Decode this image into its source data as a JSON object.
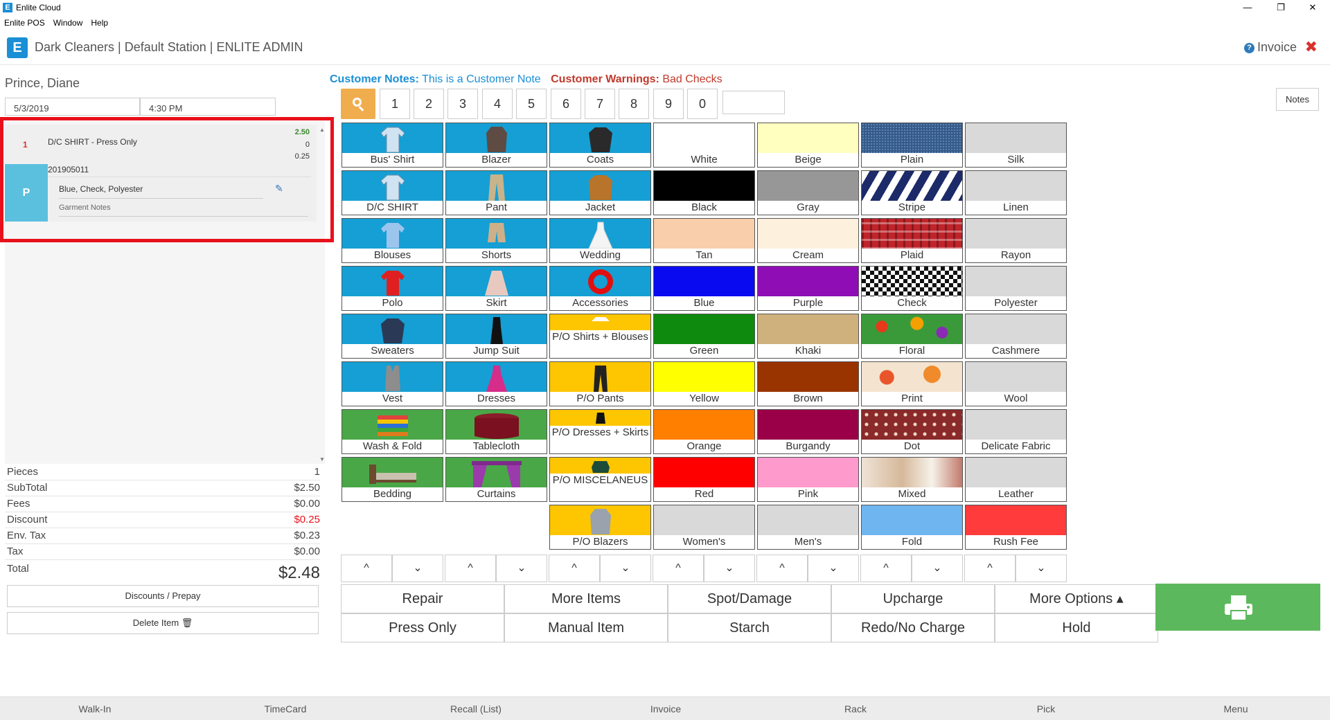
{
  "window": {
    "title": "Enlite Cloud",
    "minimize": "—",
    "restore": "❐",
    "close": "✕"
  },
  "menu": [
    "Enlite POS",
    "Window",
    "Help"
  ],
  "header": {
    "station": "Dark Cleaners | Default Station | ENLITE ADMIN",
    "invoice_label": "Invoice",
    "close_icon": "✖"
  },
  "customer": {
    "name": "Prince, Diane",
    "date": "5/3/2019",
    "time": "4:30 PM"
  },
  "item": {
    "qty": "1",
    "title": "D/C SHIRT - Press Only",
    "price": "2.50",
    "v2": "0",
    "v3": "0.25",
    "ticket": "201905011",
    "badge": "P",
    "attributes": "Blue, Check, Polyester",
    "notes": "Garment Notes"
  },
  "summary": {
    "pieces_label": "Pieces",
    "pieces": "1",
    "subtotal_label": "SubTotal",
    "subtotal": "$2.50",
    "fees_label": "Fees",
    "fees": "$0.00",
    "discount_label": "Discount",
    "discount": "$0.25",
    "envtax_label": "Env. Tax",
    "envtax": "$0.23",
    "tax_label": "Tax",
    "tax": "$0.00",
    "total_label": "Total",
    "total": "$2.48"
  },
  "left_buttons": {
    "discounts": "Discounts / Prepay",
    "delete": "Delete Item 🗑"
  },
  "notes": {
    "notes_label": "Customer Notes:",
    "notes_value": "This is a Customer Note",
    "warn_label": "Customer Warnings:",
    "warn_value": "Bad Checks",
    "notes_button": "Notes"
  },
  "keypad": [
    "1",
    "2",
    "3",
    "4",
    "5",
    "6",
    "7",
    "8",
    "9",
    "0"
  ],
  "tiles": {
    "col1": [
      "Bus' Shirt",
      "D/C SHIRT",
      "Blouses",
      "Polo",
      "Sweaters",
      "Vest",
      "Wash & Fold",
      "Bedding"
    ],
    "col2": [
      "Blazer",
      "Pant",
      "Shorts",
      "Skirt",
      "Jump Suit",
      "Dresses",
      "Tablecloth",
      "Curtains"
    ],
    "col3": [
      "Coats",
      "Jacket",
      "Wedding",
      "Accessories",
      "P/O Shirts + Blouses",
      "P/O Pants",
      "P/O Dresses + Skirts",
      "P/O MISCELANEUS",
      "P/O Blazers"
    ],
    "col4": [
      "White",
      "Black",
      "Tan",
      "Blue",
      "Green",
      "Yellow",
      "Orange",
      "Red",
      "Women's"
    ],
    "col5": [
      "Beige",
      "Gray",
      "Cream",
      "Purple",
      "Khaki",
      "Brown",
      "Burgandy",
      "Pink",
      "Men's"
    ],
    "col6": [
      "Plain",
      "Stripe",
      "Plaid",
      "Check",
      "Floral",
      "Print",
      "Dot",
      "Mixed",
      "Fold"
    ],
    "col7": [
      "Silk",
      "Linen",
      "Rayon",
      "Polyester",
      "Cashmere",
      "Wool",
      "Delicate Fabric",
      "Leather",
      "Rush Fee"
    ]
  },
  "colors": {
    "garment": "#159fd4",
    "laundry": "#4aa747",
    "presson": "#fdc600",
    "col4": [
      "#ffffff",
      "#000000",
      "#f9ceaa",
      "#0a0af0",
      "#0e8a0e",
      "#ffff00",
      "#ff7f00",
      "#ff0000",
      "#d9d9d9"
    ],
    "col5": [
      "#ffffc0",
      "#979797",
      "#fdf0dc",
      "#8e0db4",
      "#cfb17e",
      "#993300",
      "#990048",
      "#ff9bcc",
      "#d9d9d9"
    ],
    "col7_fill": "#d9d9d9",
    "fold": "#6fb5ef",
    "rush": "#ff3b3b"
  },
  "actions": {
    "row1": [
      "Repair",
      "More Items",
      "Spot/Damage",
      "Upcharge",
      "More Options ▴"
    ],
    "row2": [
      "Press Only",
      "Manual Item",
      "Starch",
      "Redo/No Charge",
      "Hold"
    ]
  },
  "arrows": {
    "up": "^",
    "down": "⌄"
  },
  "bottom_nav": [
    "Walk-In",
    "TimeCard",
    "Recall (List)",
    "Invoice",
    "Rack",
    "Pick",
    "Menu"
  ]
}
